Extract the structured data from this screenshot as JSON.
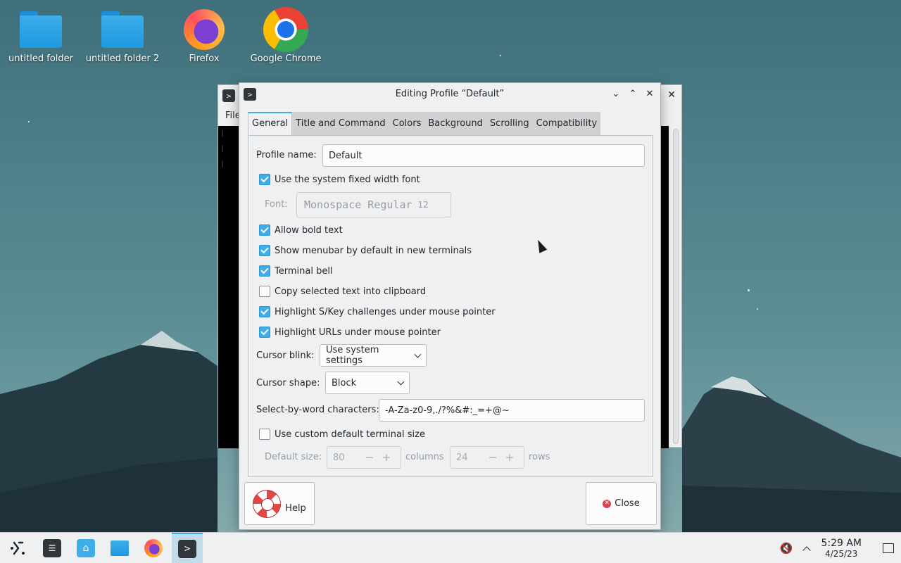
{
  "desktop": {
    "icons": [
      {
        "label": "untitled folder"
      },
      {
        "label": "untitled folder 2"
      },
      {
        "label": "Firefox"
      },
      {
        "label": "Google Chrome"
      }
    ]
  },
  "terminal": {
    "menu_label": "File"
  },
  "dialog": {
    "title": "Editing Profile “Default”",
    "tabs": [
      "General",
      "Title and Command",
      "Colors",
      "Background",
      "Scrolling",
      "Compatibility"
    ],
    "active_tab": "General",
    "profile_name_label": "Profile name:",
    "profile_name_value": "Default",
    "options": {
      "system_font": {
        "label": "Use the system fixed width font",
        "checked": true
      },
      "font_label": "Font:",
      "font_name": "Monospace Regular",
      "font_size": "12",
      "bold": {
        "label": "Allow bold text",
        "checked": true
      },
      "menubar": {
        "label": "Show menubar by default in new terminals",
        "checked": true
      },
      "bell": {
        "label": "Terminal bell",
        "checked": true
      },
      "copy": {
        "label": "Copy selected text into clipboard",
        "checked": false
      },
      "skey": {
        "label": "Highlight S/Key challenges under mouse pointer",
        "checked": true
      },
      "urls": {
        "label": "Highlight URLs under mouse pointer",
        "checked": true
      }
    },
    "cursor_blink_label": "Cursor blink:",
    "cursor_blink_value": "Use system settings",
    "cursor_shape_label": "Cursor shape:",
    "cursor_shape_value": "Block",
    "word_chars_label": "Select-by-word characters:",
    "word_chars_value": "-A-Za-z0-9,./?%&#:_=+@~",
    "custom_size": {
      "label": "Use custom default terminal size",
      "checked": false
    },
    "default_size_label": "Default size:",
    "columns_value": "80",
    "columns_label": "columns",
    "rows_value": "24",
    "rows_label": "rows",
    "help_label": "Help",
    "close_label": "Close"
  },
  "taskbar": {
    "time": "5:29 AM",
    "date": "4/25/23"
  },
  "colors": {
    "accent": "#3daee9",
    "window_bg": "#eff0f1",
    "close_red": "#da4453"
  }
}
